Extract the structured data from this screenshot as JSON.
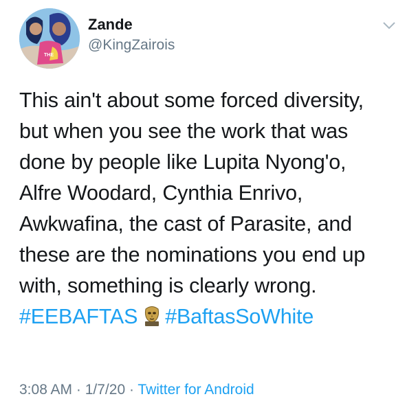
{
  "author": {
    "display_name": "Zande",
    "handle": "@KingZairois"
  },
  "tweet": {
    "lines": [
      "This ain't about some forced diversity,",
      "but when you see the work that was",
      "done by people like Lupita Nyong'o,",
      "Alfre Woodard, Cynthia Enrivo,",
      "Awkwafina, the cast of Parasite, and",
      "these are the nominations you end up",
      "with, something is clearly wrong."
    ],
    "hashtags": [
      "#EEBAFTAS",
      "#BaftasSoWhite"
    ],
    "emoji": "bafta-mask-emoji"
  },
  "meta": {
    "time": "3:08 AM",
    "separator1": " · ",
    "date": "1/7/20",
    "separator2": " · ",
    "source": "Twitter for Android"
  },
  "icons": {
    "more": "chevron-down-icon"
  },
  "colors": {
    "text": "#14171a",
    "secondary": "#657786",
    "link": "#1da1f2"
  }
}
